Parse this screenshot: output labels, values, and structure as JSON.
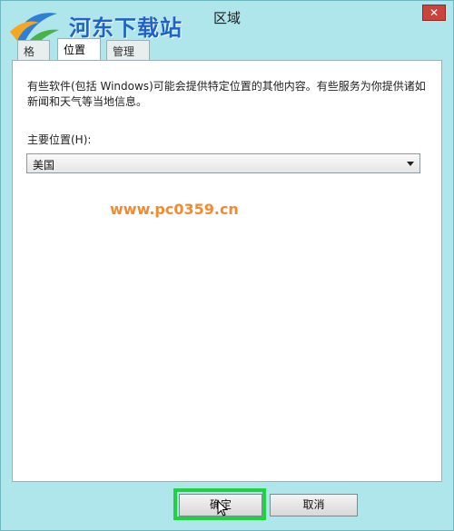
{
  "window": {
    "title": "区域",
    "close_label": "✕"
  },
  "watermark": {
    "text": "河东下载站",
    "url": "www.pc0359.cn"
  },
  "tabs": [
    {
      "label": "格式"
    },
    {
      "label": "位置"
    },
    {
      "label": "管理"
    }
  ],
  "location": {
    "description": "有些软件(包括 Windows)可能会提供特定位置的其他内容。有些服务为你提供诸如新闻和天气等当地信息。",
    "label": "主要位置(H):",
    "selected_value": "美国"
  },
  "buttons": {
    "ok": "确定",
    "cancel": "取消"
  },
  "colors": {
    "highlight": "#1ed43d",
    "frame": "#aee6ec",
    "watermark_text": "#1f63c8",
    "watermark_url": "#f38b2e"
  }
}
